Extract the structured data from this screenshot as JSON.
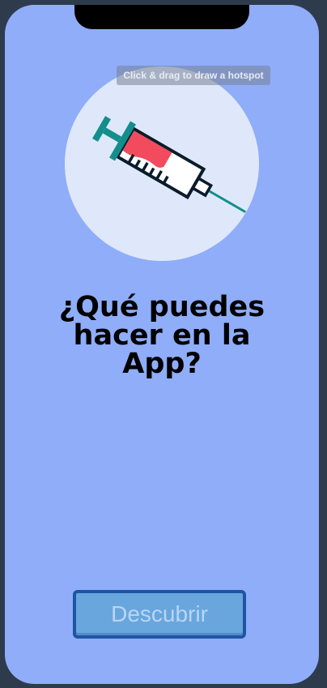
{
  "tooltip": {
    "text": "Click & drag to draw a hotspot"
  },
  "hero": {
    "icon": "syringe-icon"
  },
  "title": {
    "line1": "¿Qué puedes",
    "line2": "hacer en la",
    "line3": "App?"
  },
  "discover_button": {
    "label": "Descubrir"
  },
  "colors": {
    "background": "#8fadf9",
    "circle": "#dfe8fb",
    "button_fill": "#69a6dd",
    "button_border": "#1d55a4",
    "syringe_teal": "#138e8c",
    "syringe_red": "#f24b5d"
  }
}
